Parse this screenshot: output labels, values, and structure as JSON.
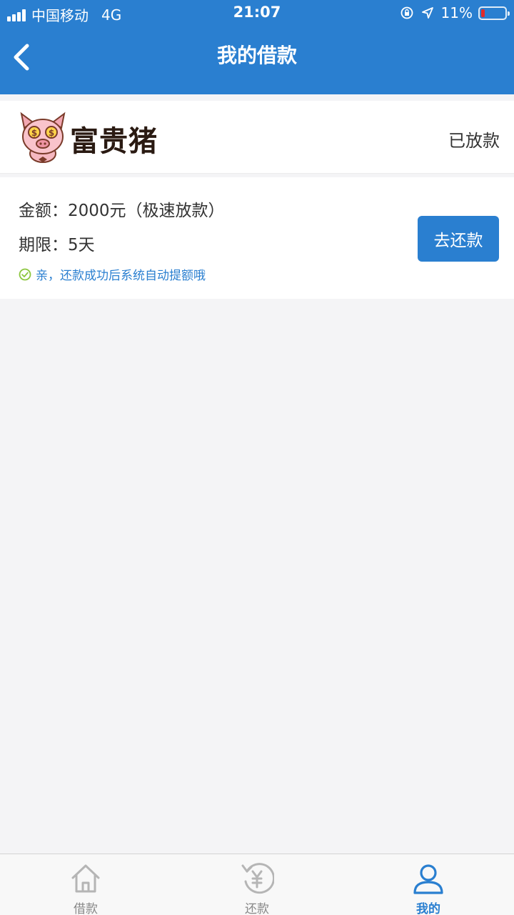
{
  "status_bar": {
    "carrier": "中国移动",
    "network": "4G",
    "time": "21:07",
    "battery": "11%",
    "battery_level": 0.11
  },
  "header": {
    "title": "我的借款",
    "back_icon": "chevron-left-icon"
  },
  "brand": {
    "name": "富贵猪",
    "status": "已放款",
    "logo_icon": "pig-logo-icon"
  },
  "loan": {
    "amount": "金额：2000元（极速放款）",
    "term": "期限：5天",
    "tip": "亲，还款成功后系统自动提额哦",
    "repay_label": "去还款"
  },
  "tabs": [
    {
      "label": "借款",
      "icon": "home-icon",
      "active": false
    },
    {
      "label": "还款",
      "icon": "repay-yen-icon",
      "active": false
    },
    {
      "label": "我的",
      "icon": "user-icon",
      "active": true
    }
  ],
  "colors": {
    "primary": "#2a7fd0",
    "background": "#f4f4f6",
    "tip_check": "#8cc63f",
    "battery_low": "#e02a2a"
  }
}
